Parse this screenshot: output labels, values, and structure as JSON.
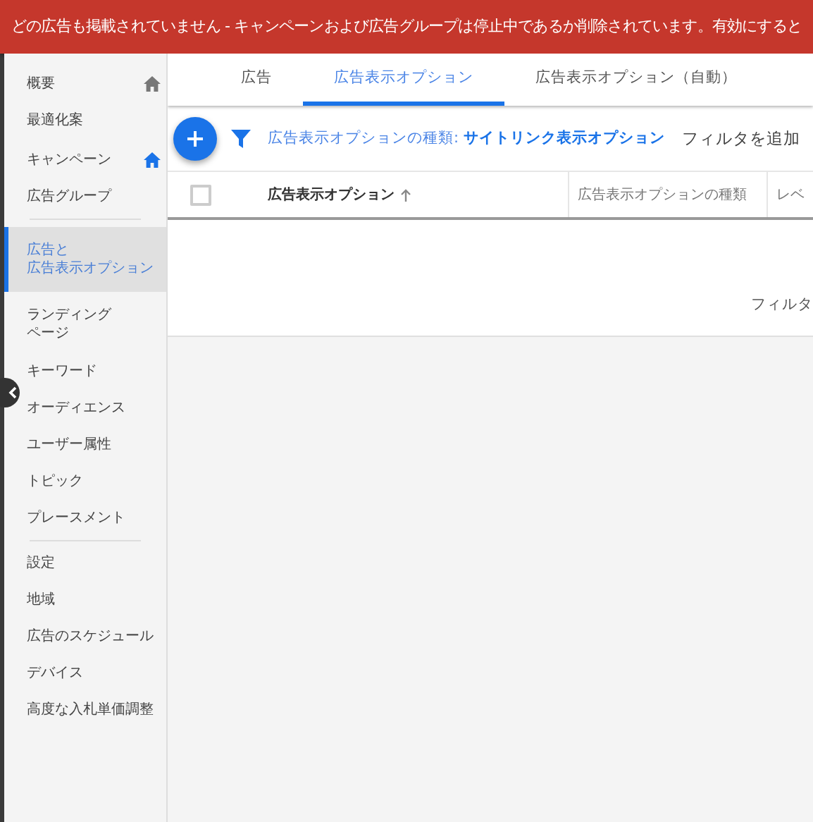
{
  "banner": {
    "text": "どの広告も掲載されていません - キャンペーンおよび広告グループは停止中であるか削除されています。有効にすると"
  },
  "sidebar": {
    "sections": [
      {
        "items": [
          {
            "label": "概要",
            "marker_highlighted": false,
            "selected": false
          },
          {
            "label": "最適化案",
            "selected": false
          },
          {
            "label": "キャンペーン",
            "marker_highlighted": true,
            "selected": false
          },
          {
            "label": "広告グループ",
            "selected": false
          }
        ]
      },
      {
        "items": [
          {
            "lines": [
              "広告と",
              "広告表示オプション"
            ],
            "selected": true
          },
          {
            "lines": [
              "ランディング",
              "ページ"
            ],
            "selected": false
          },
          {
            "label": "キーワード",
            "selected": false
          },
          {
            "label": "オーディエンス",
            "selected": false
          },
          {
            "label": "ユーザー属性",
            "selected": false
          },
          {
            "label": "トピック",
            "selected": false
          },
          {
            "label": "プレースメント",
            "selected": false
          }
        ]
      },
      {
        "items": [
          {
            "label": "設定",
            "selected": false
          },
          {
            "label": "地域",
            "selected": false
          },
          {
            "label": "広告のスケジュール",
            "selected": false
          },
          {
            "label": "デバイス",
            "selected": false
          },
          {
            "label": "高度な入札単価調整",
            "selected": false
          }
        ]
      }
    ]
  },
  "tabs": [
    {
      "label": "広告",
      "selected": false
    },
    {
      "label": "広告表示オプション",
      "selected": true
    },
    {
      "label": "広告表示オプション（自動）",
      "selected": false
    }
  ],
  "toolbar": {
    "filter_label": "広告表示オプションの種類: **サイトリンク表示オプション**",
    "add_filter": "フィルタを追加"
  },
  "table": {
    "select_all_checked": false,
    "columns": [
      {
        "label": "広告表示オプション",
        "sorted": true
      },
      {
        "label": "広告表示オプションの種類",
        "sorted": false
      },
      {
        "label": "レベ",
        "sorted": false
      }
    ],
    "empty_message": "フィルタ"
  }
}
